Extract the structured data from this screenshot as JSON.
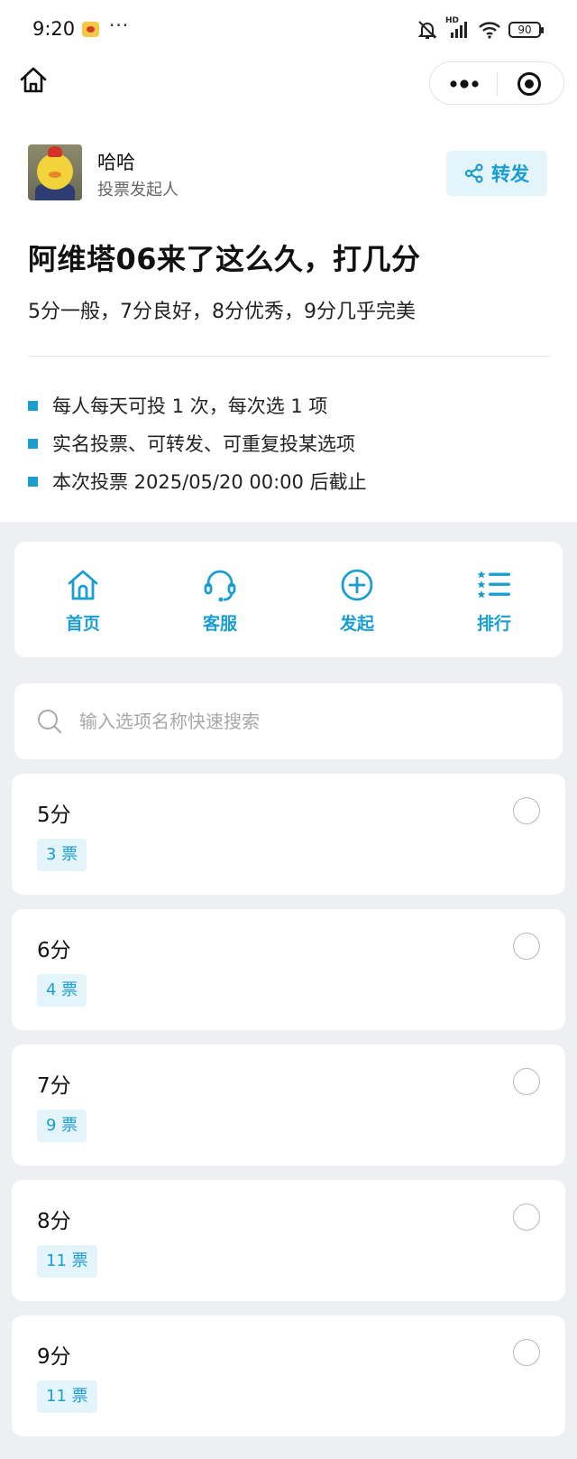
{
  "status_bar": {
    "time": "9:20",
    "more": "···",
    "hd": "HD",
    "battery": "90"
  },
  "author": {
    "name": "哈哈",
    "role": "投票发起人"
  },
  "share": {
    "label": "转发"
  },
  "poll": {
    "title": "阿维塔06来了这么久，打几分",
    "subtitle": "5分一般，7分良好，8分优秀，9分几乎完美"
  },
  "rules": [
    "每人每天可投 1 次，每次选 1 项",
    "实名投票、可转发、可重复投某选项",
    "本次投票 2025/05/20 00:00 后截止"
  ],
  "toolbar": [
    {
      "label": "首页",
      "icon": "home-icon"
    },
    {
      "label": "客服",
      "icon": "headset-icon"
    },
    {
      "label": "发起",
      "icon": "plus-circle-icon"
    },
    {
      "label": "排行",
      "icon": "ranking-list-icon"
    }
  ],
  "search": {
    "placeholder": "输入选项名称快速搜索"
  },
  "options": [
    {
      "name": "5分",
      "votes": "3 票"
    },
    {
      "name": "6分",
      "votes": "4 票"
    },
    {
      "name": "7分",
      "votes": "9 票"
    },
    {
      "name": "8分",
      "votes": "11 票"
    },
    {
      "name": "9分",
      "votes": "11 票"
    }
  ],
  "colors": {
    "accent": "#1a9ed2",
    "accent_bg": "#e4f4fb",
    "page_bg": "#eeeff3"
  }
}
